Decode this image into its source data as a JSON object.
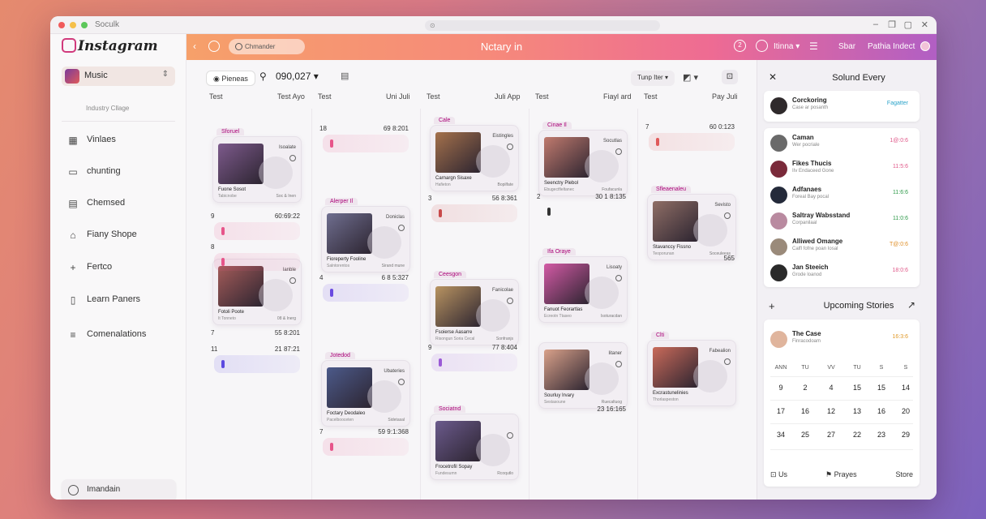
{
  "window": {
    "title": "Soculk",
    "url": "⊙"
  },
  "sidebar": {
    "logo": "Instagram",
    "account": {
      "name": "Music",
      "sub": "Industry Cllage"
    },
    "items": [
      {
        "label": "Vinlaes",
        "icon": "grid-icon"
      },
      {
        "label": "chunting",
        "icon": "chat-icon"
      },
      {
        "label": "Chemsed",
        "icon": "document-icon"
      },
      {
        "label": "Fiany Shope",
        "icon": "shop-icon"
      },
      {
        "label": "Fertco",
        "icon": "plus-icon"
      },
      {
        "label": "Learn Paners",
        "icon": "book-icon"
      },
      {
        "label": "Comenalations",
        "icon": "filter-icon"
      }
    ],
    "footer": "Imandain"
  },
  "topbar": {
    "back": "‹",
    "search_placeholder": "Chmander",
    "title": "Nctary in",
    "badge": "2",
    "user1": "Itinna",
    "user2": "Sbar",
    "profile": "Pathia Indect"
  },
  "toolbar": {
    "filter_btn": "Pieneas",
    "date": "090,027",
    "view": "Tunp Iter",
    "colors": {
      "accent": "#e7558a"
    }
  },
  "columns": [
    {
      "left": "Test",
      "right": "Test Ayo"
    },
    {
      "left": "Test",
      "right": "Uni Juli"
    },
    {
      "left": "Test",
      "right": "Juli App"
    },
    {
      "left": "Test",
      "right": "Fiayl ard"
    },
    {
      "left": "Test",
      "right": "Pay Juli"
    }
  ],
  "cards": [
    {
      "tag": "Sforuel",
      "badge": "Isoalate",
      "cap": "Fuone Sosot",
      "cap2": "Tabicnobe",
      "date": "Soc & Inen"
    },
    {
      "tag": "",
      "badge": "lanble",
      "cap": "Fotoli Poote",
      "cap2": "It Tonneto",
      "date": "08 & Inerg"
    },
    {
      "tag": "Alerper Il",
      "badge": "Doniclas",
      "cap": "Fioreperty Fooline",
      "cap2": "Salntorentos",
      "date": "Sirand mune"
    },
    {
      "tag": "Jotedod",
      "badge": "Ubateries",
      "cap": "Foctary Deodaleo",
      "cap2": "Pacelbooceten",
      "date": "Sidetasal"
    },
    {
      "tag": "Cale",
      "badge": "Eistingles",
      "cap": "Carnargn Sisaxe",
      "cap2": "Hafieton",
      "date": "Bopilfate"
    },
    {
      "tag": "Ceesgon",
      "badge": "Fanicolae",
      "cap": "Fsoierse Aasarre",
      "cap2": "Risongun Soria Cecal",
      "date": "Sonfranjs"
    },
    {
      "tag": "Sociatnd",
      "badge": "",
      "cap": "Frocetrofil Sopay",
      "cap2": "Fundesumn",
      "date": "Rcoqutlo"
    },
    {
      "tag": "Cinae Il",
      "badge": "Socutlas",
      "cap": "Seenctry Plebol",
      "cap2": "Ebugectfieltanec",
      "date": "Foufacunla"
    },
    {
      "tag": "Ifa Oraye",
      "badge": "Lisoaty",
      "cap": "Fanuot Feorartlas",
      "cap2": "Ecreotn Ttaseo",
      "date": "Isoturacdan"
    },
    {
      "tag": "",
      "badge": "Iitaner",
      "cap": "Sourluy Irvary",
      "cap2": "Sestasoune",
      "date": "Ruecaltuog"
    },
    {
      "tag": "Sfleaenaleu",
      "badge": "Sevisto",
      "cap": "Stavanccy Fissno",
      "cap2": "Teoporunan",
      "date": "Soceuleeas"
    },
    {
      "tag": "Clti",
      "badge": "Fabealion",
      "cap": "Excrastunelinies",
      "cap2": "Thorlaspeston",
      "date": ""
    }
  ],
  "rows": [
    {
      "n": "9",
      "v": "60:69:22"
    },
    {
      "n": "8",
      "v": ""
    },
    {
      "n": "7",
      "v": "55 8:201"
    },
    {
      "n": "11",
      "v": "21 87:21"
    },
    {
      "n": "18",
      "v": "69 8:201"
    },
    {
      "n": "4",
      "v": "6 8 5:327"
    },
    {
      "n": "7",
      "v": "59 9:1:368"
    },
    {
      "n": "3",
      "v": "56 8:361"
    },
    {
      "n": "9",
      "v": "77 8:404"
    },
    {
      "n": "2",
      "v": "30 1 8:135"
    },
    {
      "n": "",
      "v": "23 16:165"
    },
    {
      "n": "7",
      "v": "60 0:123"
    },
    {
      "n": "",
      "v": "565"
    }
  ],
  "right_panel": {
    "title": "Solund Every",
    "featured": {
      "name": "Corckoring",
      "sub": "Case ar posanth",
      "value": "Fagatter"
    },
    "people": [
      {
        "name": "Caman",
        "sub": "Wer pocriale",
        "value": "1@:0:6"
      },
      {
        "name": "Fikes Thucis",
        "sub": "IIv Endaceed Gone",
        "value": "11:5:6"
      },
      {
        "name": "Adfanaes",
        "sub": "Foreal Bay pocal",
        "value": "11:6:6"
      },
      {
        "name": "Saltray Wabsstand",
        "sub": "Corpanilaal",
        "value": "11:0:6"
      },
      {
        "name": "Alliwed Omange",
        "sub": "Calfl fofne poan Iosal",
        "value": "T@:0:6"
      },
      {
        "name": "Jan Steeich",
        "sub": "Grode loanod",
        "value": "18:0:6"
      }
    ],
    "upcoming_title": "Upcoming Stories",
    "story": {
      "name": "The Case",
      "sub": "Finracodoam",
      "value": "16:3:6"
    },
    "calendar": {
      "days": [
        "ANN",
        "TU",
        "VV",
        "TU",
        "S",
        "S"
      ],
      "weeks": [
        [
          "9",
          "2",
          "4",
          "15",
          "15",
          "14"
        ],
        [
          "17",
          "16",
          "12",
          "13",
          "16",
          "20"
        ],
        [
          "34",
          "25",
          "27",
          "22",
          "23",
          "29"
        ]
      ]
    },
    "footer": [
      "Us",
      "Prayes",
      "Store"
    ]
  }
}
